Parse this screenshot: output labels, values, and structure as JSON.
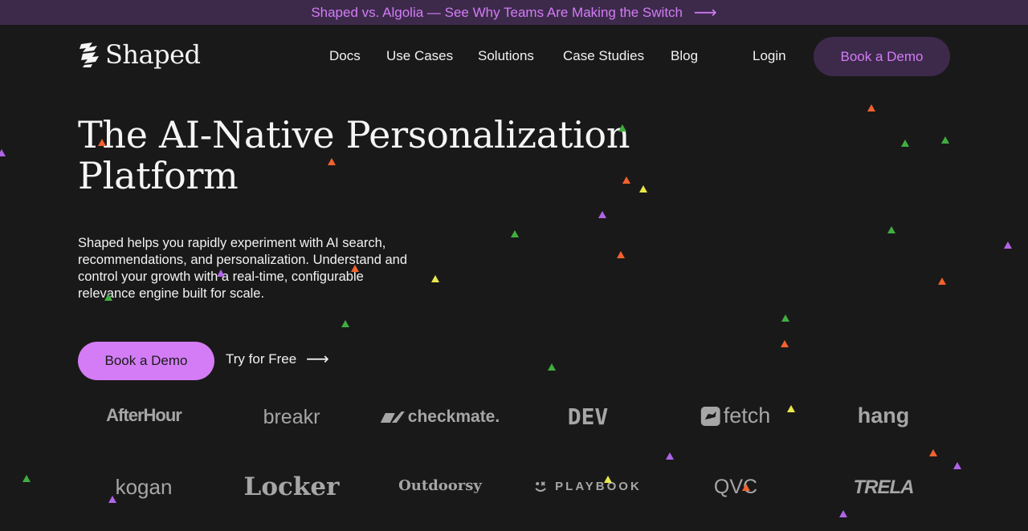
{
  "banner": {
    "text": "Shaped vs. Algolia — See Why Teams Are Making the Switch",
    "arrow": "⟶"
  },
  "nav": {
    "logo_text": "Shaped",
    "links": [
      "Docs",
      "Use Cases",
      "Solutions",
      "Case Studies",
      "Blog"
    ],
    "login": "Login",
    "demo": "Book a Demo"
  },
  "hero": {
    "title_line1": "The AI-Native Personalization",
    "title_line2": "Platform",
    "description": "Shaped helps you rapidly experiment with AI search, recommendations, and personalization. Understand and control your growth with a real-time, configurable relevance engine built for scale.",
    "primary_cta": "Book a Demo",
    "secondary_cta": "Try for Free",
    "secondary_arrow": "⟶"
  },
  "customer_logos": {
    "row1": [
      "AfterHour",
      "breakr",
      "checkmate.",
      "DEV",
      "fetch",
      "hang"
    ],
    "row2": [
      "kogan",
      "Locker",
      "Outdoorsy",
      "PLAYBOOK",
      "QVC",
      "TRELA"
    ]
  },
  "colors": {
    "background": "#1a191a",
    "banner_bg": "#3d2a4b",
    "accent": "#d37cf5",
    "particle_orange": "#f2622e",
    "particle_green": "#3fae3f",
    "particle_yellow": "#e8e84a",
    "particle_purple": "#b064e8"
  }
}
